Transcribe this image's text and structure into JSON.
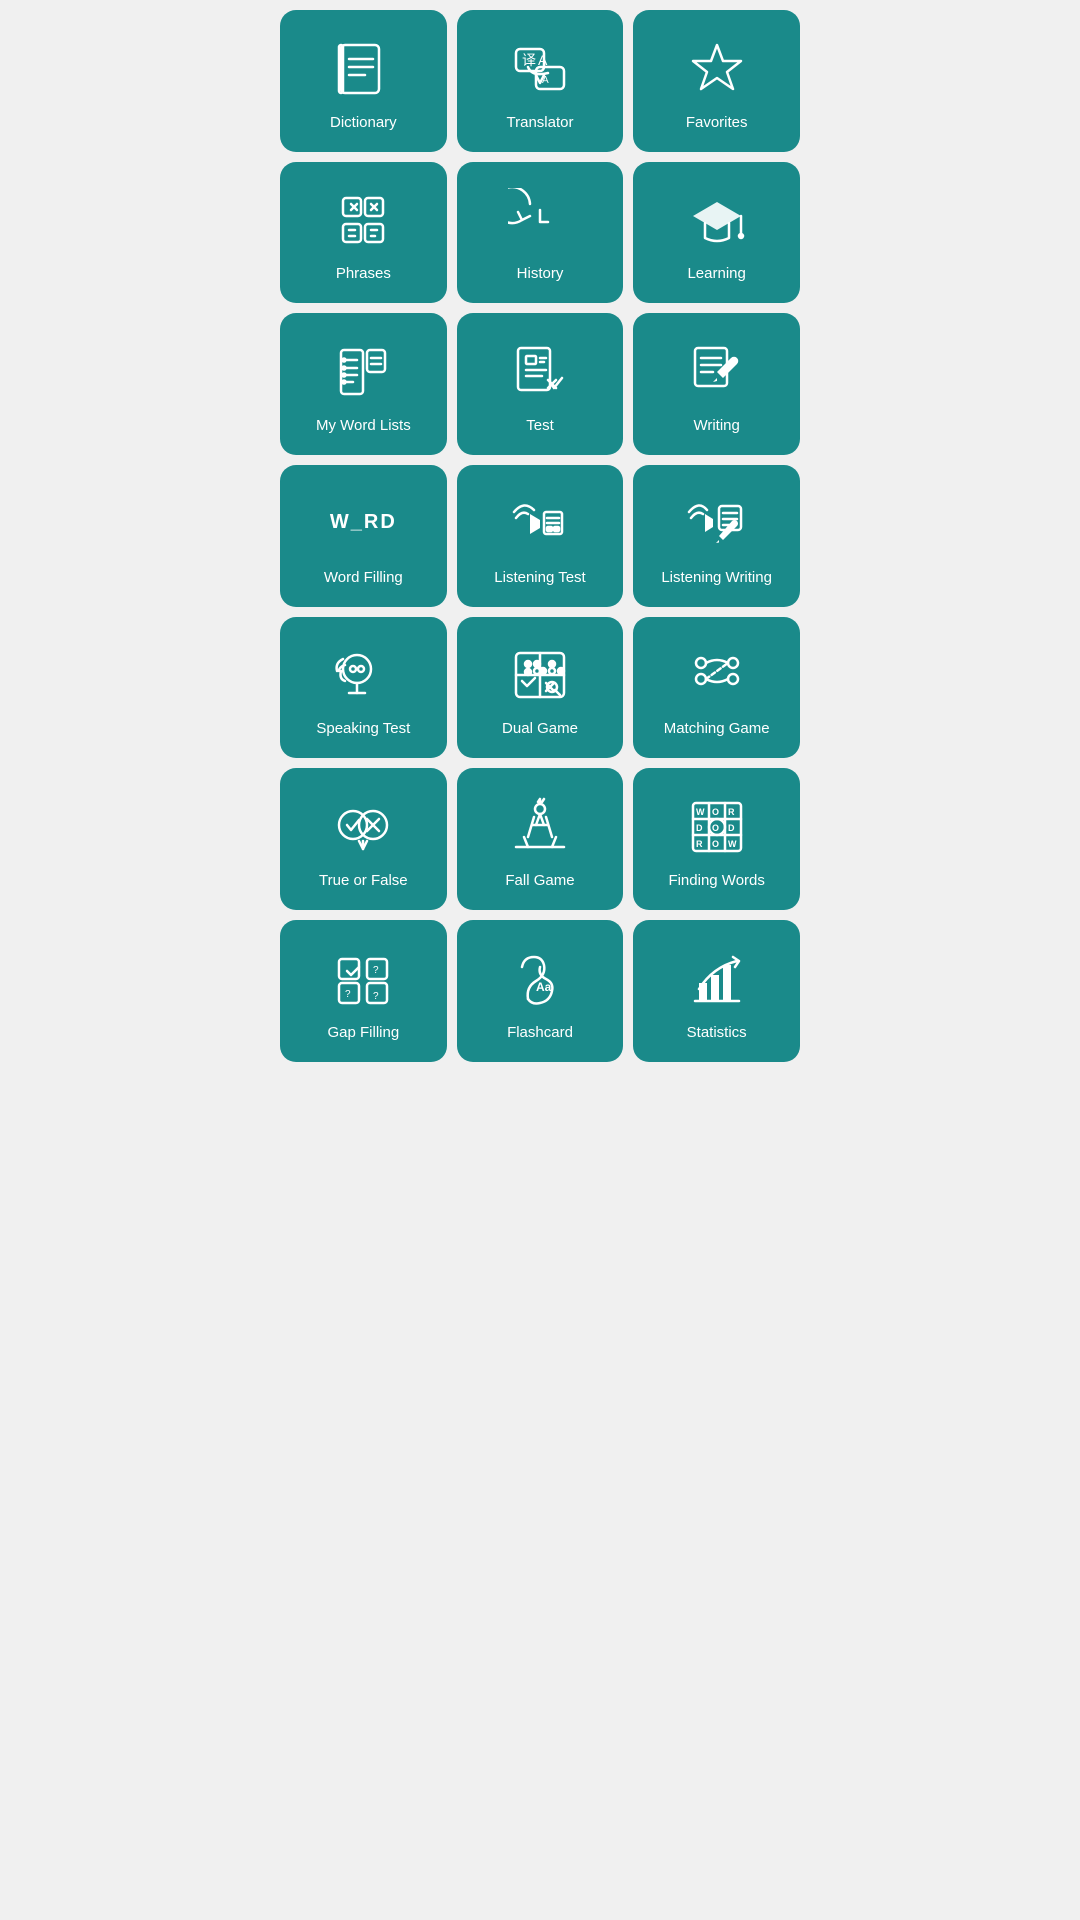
{
  "tiles": [
    {
      "id": "dictionary",
      "label": "Dictionary",
      "icon": "dictionary"
    },
    {
      "id": "translator",
      "label": "Translator",
      "icon": "translator"
    },
    {
      "id": "favorites",
      "label": "Favorites",
      "icon": "favorites"
    },
    {
      "id": "phrases",
      "label": "Phrases",
      "icon": "phrases"
    },
    {
      "id": "history",
      "label": "History",
      "icon": "history"
    },
    {
      "id": "learning",
      "label": "Learning",
      "icon": "learning"
    },
    {
      "id": "my-word-lists",
      "label": "My Word Lists",
      "icon": "wordlists"
    },
    {
      "id": "test",
      "label": "Test",
      "icon": "test"
    },
    {
      "id": "writing",
      "label": "Writing",
      "icon": "writing"
    },
    {
      "id": "word-filling",
      "label": "Word Filling",
      "icon": "wordfilling"
    },
    {
      "id": "listening-test",
      "label": "Listening Test",
      "icon": "listeningtest"
    },
    {
      "id": "listening-writing",
      "label": "Listening Writing",
      "icon": "listeningwriting"
    },
    {
      "id": "speaking-test",
      "label": "Speaking Test",
      "icon": "speakingtest"
    },
    {
      "id": "dual-game",
      "label": "Dual Game",
      "icon": "dualgame"
    },
    {
      "id": "matching-game",
      "label": "Matching Game",
      "icon": "matchinggame"
    },
    {
      "id": "true-or-false",
      "label": "True or False",
      "icon": "trueorfalse"
    },
    {
      "id": "fall-game",
      "label": "Fall Game",
      "icon": "fallgame"
    },
    {
      "id": "finding-words",
      "label": "Finding Words",
      "icon": "findingwords"
    },
    {
      "id": "gap-filling",
      "label": "Gap Filling",
      "icon": "gapfilling"
    },
    {
      "id": "flashcard",
      "label": "Flashcard",
      "icon": "flashcard"
    },
    {
      "id": "statistics",
      "label": "Statistics",
      "icon": "statistics"
    }
  ]
}
